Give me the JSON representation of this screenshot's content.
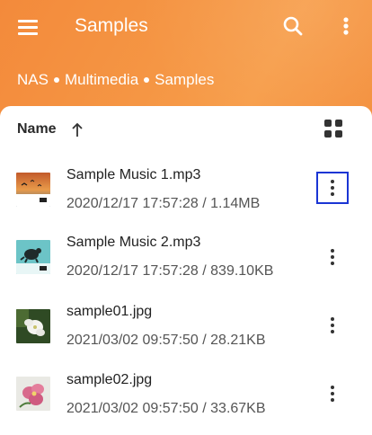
{
  "appbar": {
    "title": "Samples",
    "menu_icon": "hamburger-menu-icon",
    "search_icon": "search-icon",
    "more_icon": "more-vertical-icon",
    "gradient_colors": [
      "#f38a3b",
      "#f79e4b"
    ]
  },
  "breadcrumb": {
    "items": [
      "NAS",
      "Multimedia",
      "Samples"
    ]
  },
  "list_header": {
    "sort_label": "Name",
    "sort_icon": "arrow-up-icon",
    "view_toggle_icon": "grid-view-icon"
  },
  "files": [
    {
      "name": "Sample Music 1.mp3",
      "meta": "2020/12/17 17:57:28 / 1.14MB",
      "thumbnail": "album-art-sunset-birds",
      "menu_icon": "more-vertical-icon",
      "selected": true
    },
    {
      "name": "Sample Music 2.mp3",
      "meta": "2020/12/17 17:57:28 / 839.10KB",
      "thumbnail": "album-art-turtle",
      "menu_icon": "more-vertical-icon",
      "selected": false
    },
    {
      "name": "sample01.jpg",
      "meta": "2021/03/02 09:57:50 / 28.21KB",
      "thumbnail": "photo-white-flowers",
      "menu_icon": "more-vertical-icon",
      "selected": false
    },
    {
      "name": "sample02.jpg",
      "meta": "2021/03/02 09:57:50 / 33.67KB",
      "thumbnail": "photo-pink-flowers",
      "menu_icon": "more-vertical-icon",
      "selected": false
    }
  ],
  "colors": {
    "accent": "#f59644",
    "selection_outline": "#1a35d4",
    "text_primary": "#212121",
    "text_secondary": "#555555"
  }
}
